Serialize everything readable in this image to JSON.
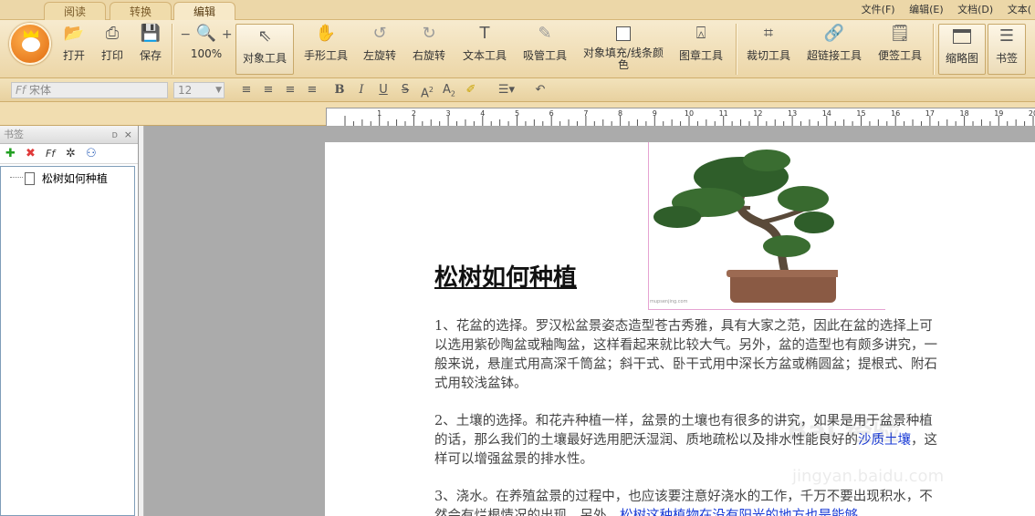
{
  "tabs": [
    "阅读",
    "转换",
    "编辑"
  ],
  "menus": [
    "文件(F)",
    "编辑(E)",
    "文档(D)",
    "文本("
  ],
  "toolbar": {
    "open": "打开",
    "print": "打印",
    "save": "保存",
    "zoom": "100%",
    "object_tool": "对象工具",
    "hand_tool": "手形工具",
    "rotate_left": "左旋转",
    "rotate_right": "右旋转",
    "text_tool": "文本工具",
    "eyedropper": "吸管工具",
    "fill_line_color": "对象填充/线条颜色",
    "stamp_tool": "图章工具",
    "crop_tool": "裁切工具",
    "hyperlink_tool": "超链接工具",
    "note_tool": "便签工具",
    "thumbnails": "缩略图",
    "bookmarks": "书签"
  },
  "format": {
    "font": "宋体",
    "size": "12"
  },
  "panel": {
    "title": "书签",
    "bookmark_item": "松树如何种植"
  },
  "document": {
    "title": "松树如何种植",
    "p1": "1、花盆的选择。罗汉松盆景姿态造型苍古秀雅，具有大家之范，因此在盆的选择上可以选用紫砂陶盆或釉陶盆，这样看起来就比较大气。另外，盆的造型也有颇多讲究，一般来说，悬崖式用高深千筒盆；斜干式、卧干式用中深长方盆或椭圆盆；提根式、附石式用较浅盆钵。",
    "p2_a": "2、土壤的选择。和花卉种植一样，盆景的土壤也有很多的讲究，如果是用于盆景种植的话，那么我们的土壤最好选用肥沃湿润、质地疏松以及排水性能良好的",
    "p2_link": "沙质土壤",
    "p2_b": "，这样可以增强盆景的排水性。",
    "p3_a": "3、浇水。在养殖盆景的过程中，也应该要注意好浇水的工作，千万不要出现积水，不然会有烂根情况的出现。另外，",
    "p3_link": "松树这种植物在没有阳光的地方也是能够",
    "image_caption": "mupsenjing.com"
  },
  "watermark": {
    "logo_text": "Bai 经验",
    "url": "jingyan.baidu.com"
  }
}
